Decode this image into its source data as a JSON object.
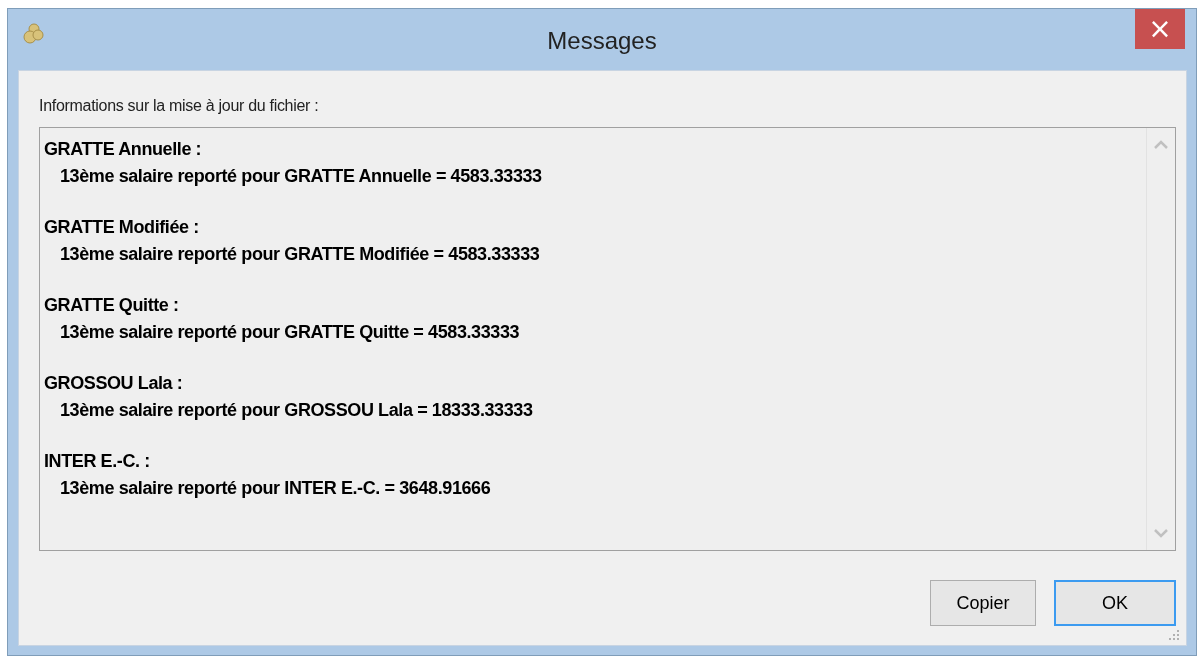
{
  "window": {
    "title": "Messages",
    "close": "×"
  },
  "label": "Informations sur la mise à jour du fichier :",
  "entries": [
    {
      "heading": "GRATTE Annuelle :",
      "detail": "13ème salaire reporté pour GRATTE Annuelle = 4583.33333"
    },
    {
      "heading": "GRATTE Modifiée :",
      "detail": "13ème salaire reporté pour GRATTE Modifiée = 4583.33333"
    },
    {
      "heading": "GRATTE Quitte :",
      "detail": "13ème salaire reporté pour GRATTE Quitte = 4583.33333"
    },
    {
      "heading": "GROSSOU Lala :",
      "detail": "13ème salaire reporté pour GROSSOU Lala = 18333.33333"
    },
    {
      "heading": "INTER E.-C. :",
      "detail": "13ème salaire reporté pour INTER E.-C. = 3648.91666"
    }
  ],
  "buttons": [
    {
      "label": "Copier",
      "default": false
    },
    {
      "label": "OK",
      "default": true
    }
  ]
}
